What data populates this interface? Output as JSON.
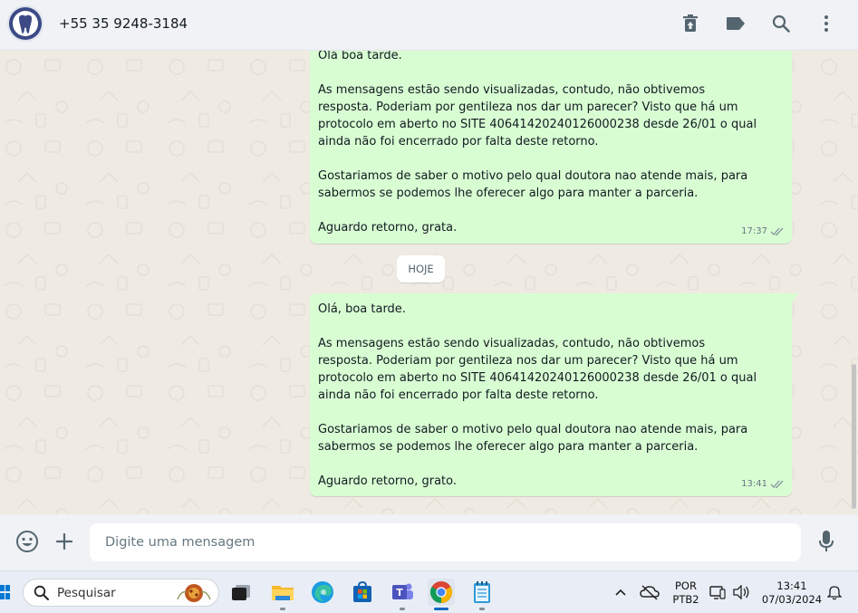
{
  "header": {
    "contact_name": "+55 35 9248-3184",
    "icons": [
      "delete-icon",
      "label-icon",
      "search-icon",
      "more-vertical-icon"
    ]
  },
  "messages": [
    {
      "text": "Olá boa tarde.\n\nAs mensagens estão sendo visualizadas, contudo, não obtivemos resposta. Poderiam por gentileza nos dar um parecer? Visto que há um protocolo em aberto no SITE 40641420240126000238 desde 26/01 o qual ainda não foi encerrado por falta deste retorno.\n\nGostariamos de saber o motivo pelo qual doutora nao atende mais, para sabermos se podemos lhe oferecer algo para manter a parceria.\n\nAguardo retorno, grata.",
      "time": "17:37"
    },
    {
      "text": "Olá, boa tarde.\n\nAs mensagens estão sendo visualizadas, contudo, não obtivemos resposta. Poderiam por gentileza nos dar um parecer? Visto que há um protocolo em aberto no SITE 40641420240126000238 desde 26/01 o qual ainda não foi encerrado por falta deste retorno.\n\nGostariamos de saber o motivo pelo qual doutora nao atende mais, para sabermos se podemos lhe oferecer algo para manter a parceria.\n\nAguardo retorno, grato.",
      "time": "13:41"
    }
  ],
  "day_separator": "HOJE",
  "composer": {
    "placeholder": "Digite uma mensagem"
  },
  "taskbar": {
    "search_placeholder": "Pesquisar",
    "language": "POR",
    "keyboard": "PTB2",
    "time": "13:41",
    "date": "07/03/2024"
  },
  "colors": {
    "bubble_out": "#d9fdd3",
    "chat_bg": "#efeae2",
    "header_bg": "#f0f2f5",
    "read_ticks": "#8696a0"
  }
}
